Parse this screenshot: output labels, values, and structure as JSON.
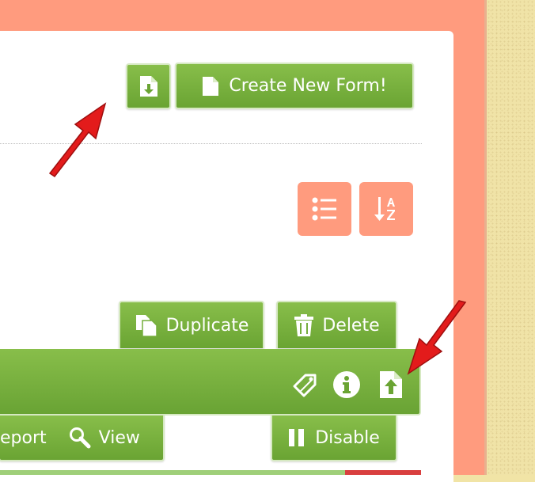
{
  "header": {
    "create_form_label": "Create New Form!",
    "import_icon": "file-download-icon",
    "create_icon": "file-icon"
  },
  "toolbar": {
    "list_view_icon": "list-icon",
    "sort_icon": "sort-alpha-icon"
  },
  "form_actions": {
    "duplicate_label": "Duplicate",
    "delete_label": "Delete",
    "report_label": "eport",
    "view_label": "View",
    "disable_label": "Disable"
  },
  "form_bar": {
    "icons": [
      "tags-icon",
      "info-icon",
      "file-upload-icon"
    ]
  },
  "colors": {
    "green": "#75ad3c",
    "salmon": "#ff9b7e",
    "paper": "#f1e4a6",
    "arrow": "#e31b1b"
  }
}
